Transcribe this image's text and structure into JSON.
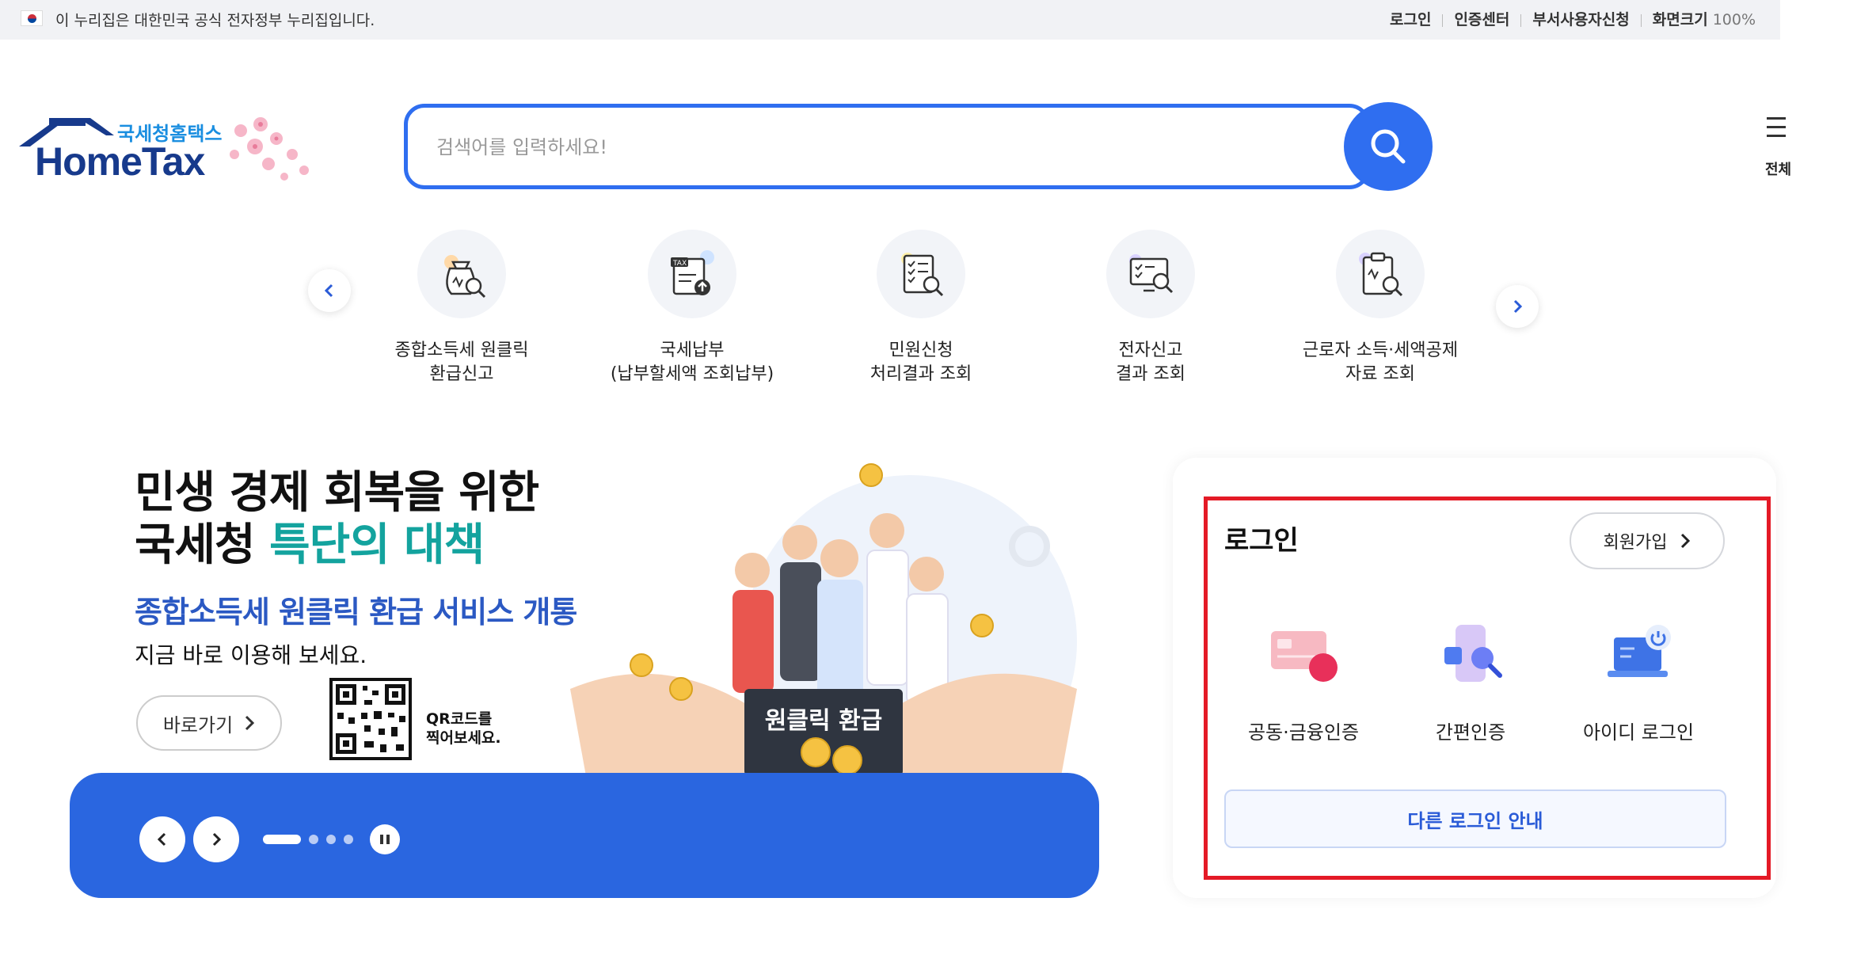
{
  "gov_bar": {
    "notice": "이 누리집은 대한민국 공식 전자정부 누리집입니다.",
    "links": [
      "로그인",
      "인증센터",
      "부서사용자신청",
      "화면크기"
    ],
    "zoom": "100%"
  },
  "logo": {
    "sub": "국세청홈택스",
    "main": "HomeTax"
  },
  "search": {
    "placeholder": "검색어를 입력하세요!"
  },
  "all_menu": {
    "label": "전체"
  },
  "quick_menu": {
    "items": [
      {
        "line1": "종합소득세 원클릭",
        "line2": "환급신고",
        "icon": "money-bag-search-icon"
      },
      {
        "line1": "국세납부",
        "line2": "(납부할세액 조회납부)",
        "icon": "tax-document-upload-icon"
      },
      {
        "line1": "민원신청",
        "line2": "처리결과 조회",
        "icon": "document-checklist-search-icon"
      },
      {
        "line1": "전자신고",
        "line2": "결과 조회",
        "icon": "monitor-search-icon"
      },
      {
        "line1": "근로자 소득·세액공제",
        "line2": "자료 조회",
        "icon": "clipboard-search-icon"
      }
    ]
  },
  "banner": {
    "title_line1": "민생 경제 회복을 위한",
    "title_line2_a": "국세청 ",
    "title_line2_b": "특단의 대책",
    "subtitle": "종합소득세 원클릭 환급 서비스 개통",
    "desc": "지금 바로 이용해 보세요.",
    "button": "바로가기",
    "qr_line1": "QR코드를",
    "qr_line2": "찍어보세요.",
    "sign_text": "원클릭 환급",
    "slides_total": 4,
    "slide_active": 1
  },
  "login": {
    "title": "로그인",
    "join_button": "회원가입",
    "methods": [
      {
        "label": "공동·금융인증",
        "icon": "certificate-card-icon"
      },
      {
        "label": "간편인증",
        "icon": "phone-search-icon"
      },
      {
        "label": "아이디 로그인",
        "icon": "laptop-power-icon"
      }
    ],
    "other_button": "다른 로그인 안내"
  },
  "colors": {
    "primary": "#2f6ef0",
    "banner_bar": "#2a66e0",
    "highlight_teal": "#13a39e",
    "subtitle_blue": "#2b59c3",
    "highlight_box": "#e41a26"
  }
}
